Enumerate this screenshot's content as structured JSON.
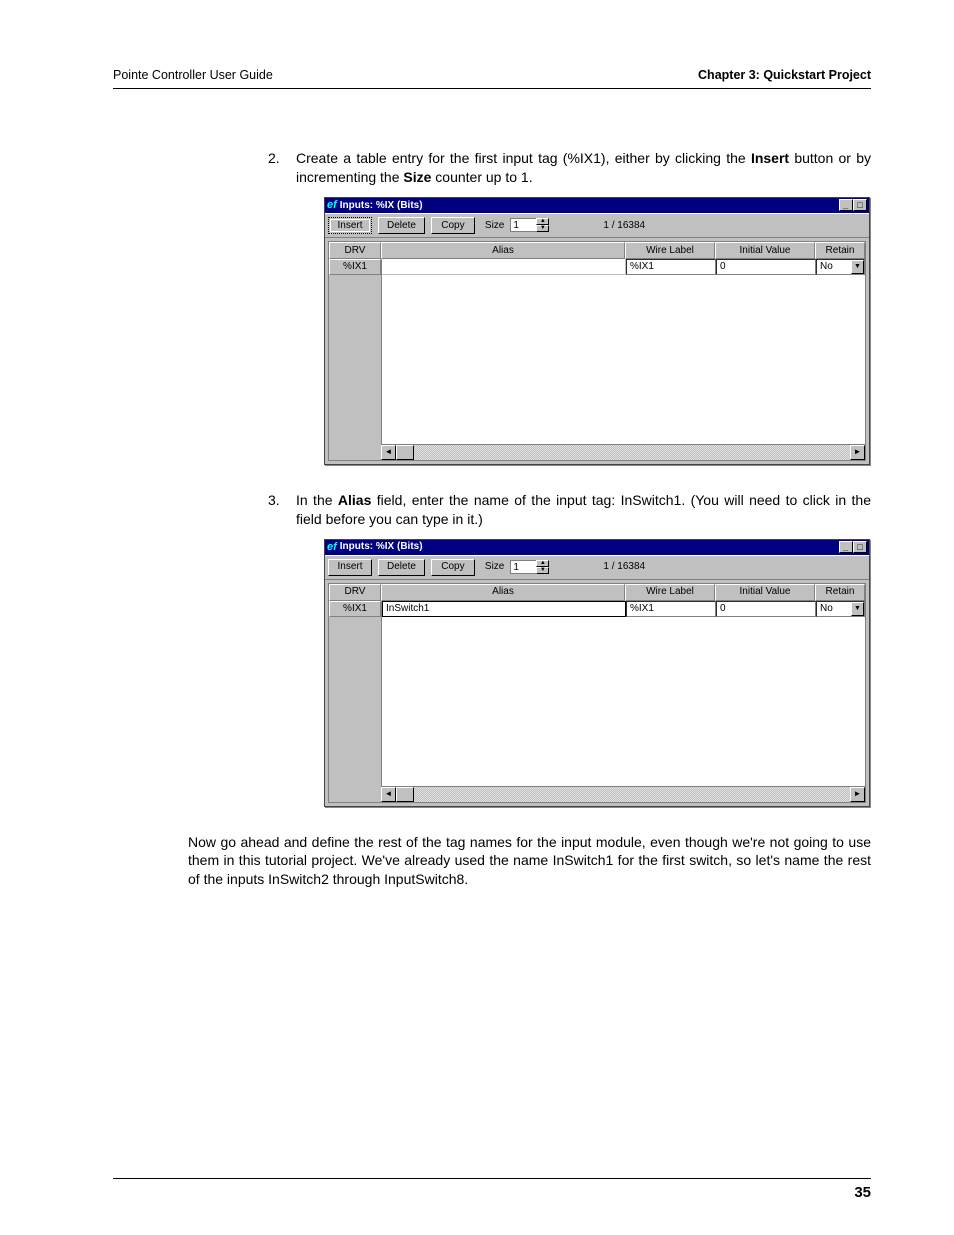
{
  "header": {
    "left": "Pointe Controller User Guide",
    "right": "Chapter 3: Quickstart Project"
  },
  "step2": {
    "num": "2.",
    "pre": "Create a table entry for the first input tag (%IX1), either by clicking the ",
    "b1": "Insert",
    "mid": " button or by incrementing the ",
    "b2": "Size",
    "post": " counter up to 1."
  },
  "shot1": {
    "title_prefix": "ef",
    "title": "Inputs: %IX (Bits)",
    "insert": "Insert",
    "delete": "Delete",
    "copy": "Copy",
    "size_label": "Size",
    "size_value": "1",
    "counter": "1 / 16384",
    "cols": {
      "drv": "DRV",
      "alias": "Alias",
      "wl": "Wire Label",
      "iv": "Initial Value",
      "rt": "Retain"
    },
    "row": {
      "drv": "%IX1",
      "alias": "",
      "wl": "%IX1",
      "iv": "0",
      "rt": "No"
    }
  },
  "step3": {
    "num": "3.",
    "pre": "In the ",
    "b1": "Alias",
    "post": " field, enter the name of the input tag: InSwitch1. (You will need to click in the field before you can type in it.)"
  },
  "shot2": {
    "title_prefix": "ef",
    "title": "Inputs: %IX (Bits)",
    "insert": "Insert",
    "delete": "Delete",
    "copy": "Copy",
    "size_label": "Size",
    "size_value": "1",
    "counter": "1 / 16384",
    "cols": {
      "drv": "DRV",
      "alias": "Alias",
      "wl": "Wire Label",
      "iv": "Initial Value",
      "rt": "Retain"
    },
    "row": {
      "drv": "%IX1",
      "alias": "InSwitch1",
      "wl": "%IX1",
      "iv": "0",
      "rt": "No"
    }
  },
  "para": "Now go ahead and define the rest of the tag names for the input module, even though we're not going to use them in this tutorial project. We've already used the name InSwitch1 for the first switch, so let's name the rest of the inputs InSwitch2 through InputSwitch8.",
  "page_num": "35",
  "glyphs": {
    "min": "_",
    "max": "□",
    "up": "▲",
    "down": "▼",
    "left": "◄",
    "right": "►",
    "dd": "▼"
  }
}
